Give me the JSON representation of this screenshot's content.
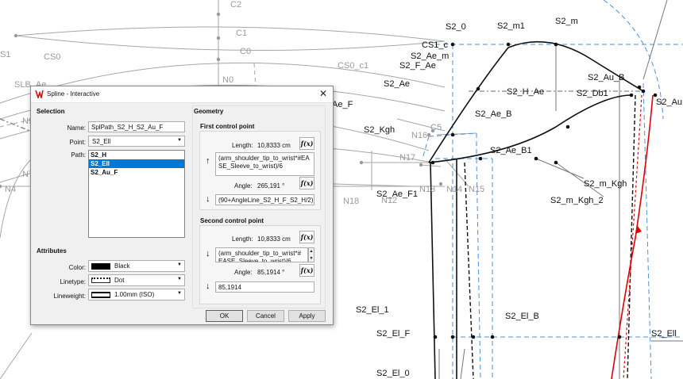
{
  "canvas": {
    "labels_black": [
      "S2_0",
      "S2_m1",
      "S2_m",
      "CS1_c",
      "S2_Ae_m",
      "S2_F_Ae",
      "S2_Ae",
      "S2_H_Ae",
      "S2_Db1",
      "S2_Au_B",
      "S2_Au",
      "S2_Ae_B",
      "S2_Kgh",
      "S2_Ae_B1",
      "S2_m_Kgh",
      "S2_m_Kgh_2",
      "S2_Ae_F1",
      "S2_El_1",
      "S2_El_B",
      "S2_El_F",
      "S2_Ell",
      "S2_El_0",
      "Ae_F"
    ],
    "labels_grey": [
      "C2",
      "C1",
      "C0",
      "S1",
      "CS0",
      "CS0_c1",
      "N0",
      "SLB_Ae",
      "N9",
      "N7",
      "N4",
      "N16",
      "N17",
      "N13",
      "N14",
      "N15",
      "N12",
      "N18",
      "C5"
    ]
  },
  "dialog": {
    "title": "Spline - Interactive",
    "close": "✕",
    "selection": {
      "title": "Selection",
      "name_label": "Name:",
      "name_value": "SplPath_S2_H_S2_Au_F",
      "point_label": "Point:",
      "point_value": "S2_Ell",
      "path_label": "Path:",
      "path_items": [
        "S2_H",
        "S2_Ell",
        "S2_Au_F"
      ]
    },
    "attributes": {
      "title": "Attributes",
      "color_label": "Color:",
      "color_value": "Black",
      "linetype_label": "Linetype:",
      "linetype_value": "Dot",
      "lineweight_label": "Lineweight:",
      "lineweight_value": "1.00mm (ISO)"
    },
    "geometry": {
      "title": "Geometry",
      "first": {
        "title": "First control point",
        "length_label": "Length:",
        "length_value": "10,8333 cm",
        "length_formula": "(arm_shoulder_tip_to_wrist*#EASE_Sleeve_to_wrist)/6",
        "angle_label": "Angle:",
        "angle_value": "265,191 °",
        "angle_formula": "(90+AngleLine_S2_H_F_S2_H/2)"
      },
      "second": {
        "title": "Second control point",
        "length_label": "Length:",
        "length_value": "10,8333 cm",
        "length_formula": "(arm_shoulder_tip_to_wrist*#EASE_Sleeve_to_wrist)/6",
        "angle_label": "Angle:",
        "angle_value": "85,1914 °",
        "angle_formula": "85,1914"
      },
      "fx": "f(x)"
    },
    "buttons": {
      "ok": "OK",
      "cancel": "Cancel",
      "apply": "Apply"
    }
  }
}
